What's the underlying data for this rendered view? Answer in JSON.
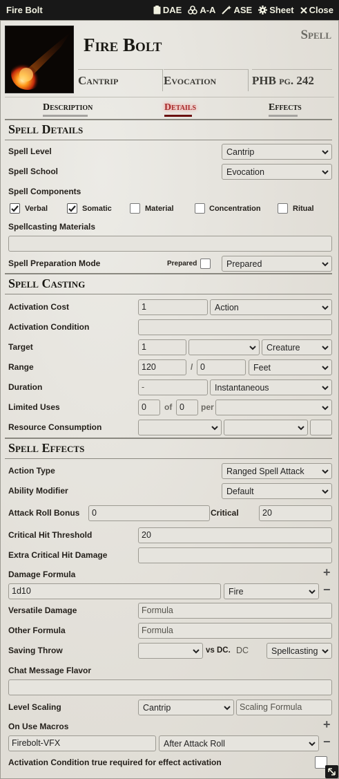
{
  "window": {
    "title": "Fire Bolt",
    "header_buttons": [
      {
        "icon": "clipboard-icon",
        "label": "DAE"
      },
      {
        "icon": "biohazard-icon",
        "label": "A-A"
      },
      {
        "icon": "magic-wand-icon",
        "label": "ASE"
      },
      {
        "icon": "gear-icon",
        "label": "Sheet"
      },
      {
        "icon": "close-icon",
        "label": "Close"
      }
    ]
  },
  "item": {
    "name": "Fire Bolt",
    "type": "Spell",
    "summary": [
      "Cantrip",
      "Evocation",
      "PHB pg. 242"
    ]
  },
  "tabs": [
    {
      "label": "Description",
      "active": false
    },
    {
      "label": "Details",
      "active": true
    },
    {
      "label": "Effects",
      "active": false
    }
  ],
  "details": {
    "heading": "Spell Details",
    "spell_level": {
      "label": "Spell Level",
      "value": "Cantrip"
    },
    "spell_school": {
      "label": "Spell School",
      "value": "Evocation"
    },
    "components_label": "Spell Components",
    "components": [
      {
        "label": "Verbal",
        "checked": true
      },
      {
        "label": "Somatic",
        "checked": true
      },
      {
        "label": "Material",
        "checked": false
      },
      {
        "label": "Concentration",
        "checked": false
      },
      {
        "label": "Ritual",
        "checked": false
      }
    ],
    "materials_label": "Spellcasting Materials",
    "materials_value": "",
    "prep_label": "Spell Preparation Mode",
    "prepared_label": "Prepared",
    "prep_mode": "Prepared"
  },
  "casting": {
    "heading": "Spell Casting",
    "activation_cost": {
      "label": "Activation Cost",
      "value": "1",
      "type": "Action"
    },
    "activation_condition": {
      "label": "Activation Condition",
      "value": ""
    },
    "target": {
      "label": "Target",
      "value": "1",
      "units": "",
      "type": "Creature"
    },
    "range": {
      "label": "Range",
      "value": "120",
      "sep": "/",
      "long": "0",
      "units": "Feet"
    },
    "duration": {
      "label": "Duration",
      "value": "-",
      "units": "Instantaneous"
    },
    "limited_uses": {
      "label": "Limited Uses",
      "value": "0",
      "of": "of",
      "max": "0",
      "per": "per",
      "period": ""
    },
    "resource": {
      "label": "Resource Consumption",
      "type": "",
      "target": "",
      "amount": ""
    }
  },
  "effects": {
    "heading": "Spell Effects",
    "action_type": {
      "label": "Action Type",
      "value": "Ranged Spell Attack"
    },
    "ability": {
      "label": "Ability Modifier",
      "value": "Default"
    },
    "attack_bonus": {
      "label": "Attack Roll Bonus",
      "value": "0",
      "critical_label": "Critical",
      "critical_value": "20"
    },
    "crit_threshold": {
      "label": "Critical Hit Threshold",
      "value": "20"
    },
    "extra_crit": {
      "label": "Extra Critical Hit Damage",
      "value": ""
    },
    "damage": {
      "label": "Damage Formula",
      "formula": "1d10",
      "type": "Fire"
    },
    "versatile": {
      "label": "Versatile Damage",
      "placeholder": "Formula"
    },
    "other": {
      "label": "Other Formula",
      "placeholder": "Formula"
    },
    "saving": {
      "label": "Saving Throw",
      "ability": "",
      "vs": "vs DC.",
      "dc_placeholder": "DC",
      "scaling": "Spellcasting"
    },
    "flavor": {
      "label": "Chat Message Flavor",
      "value": ""
    },
    "level_scaling": {
      "label": "Level Scaling",
      "mode": "Cantrip",
      "placeholder": "Scaling Formula"
    },
    "macros": {
      "label": "On Use Macros",
      "name": "Firebolt-VFX",
      "trigger": "After Attack Roll"
    },
    "activation_true": {
      "label": "Activation Condition true required for effect activation",
      "checked": false
    }
  }
}
